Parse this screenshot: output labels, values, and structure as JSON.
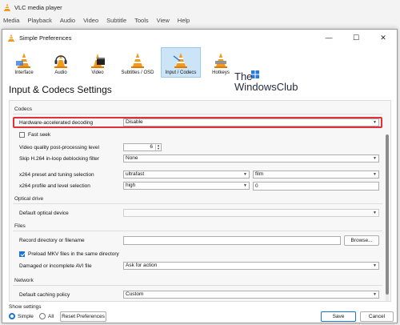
{
  "main_window": {
    "title": "VLC media player",
    "menu": [
      "Media",
      "Playback",
      "Audio",
      "Video",
      "Subtitle",
      "Tools",
      "View",
      "Help"
    ]
  },
  "dialog": {
    "title": "Simple Preferences",
    "window_buttons": {
      "minimize": "—",
      "maximize": "☐",
      "close": "✕"
    },
    "categories": [
      {
        "label": "Interface",
        "icon": "interface-cone-icon",
        "selected": false
      },
      {
        "label": "Audio",
        "icon": "audio-headphones-cone-icon",
        "selected": false
      },
      {
        "label": "Video",
        "icon": "video-clapper-cone-icon",
        "selected": false
      },
      {
        "label": "Subtitles / OSD",
        "icon": "subtitles-cone-icon",
        "selected": false
      },
      {
        "label": "Input / Codecs",
        "icon": "codecs-cone-icon",
        "selected": true
      },
      {
        "label": "Hotkeys",
        "icon": "hotkeys-cone-icon",
        "selected": false
      }
    ],
    "watermark": {
      "line1": "The",
      "line2": "WindowsClub"
    },
    "heading": "Input & Codecs Settings",
    "groups": {
      "codecs": "Codecs",
      "optical": "Optical drive",
      "files": "Files",
      "network": "Network"
    },
    "codecs": {
      "hw_decoding_label": "Hardware-accelerated decoding",
      "hw_decoding_value": "Disable",
      "fast_seek_label": "Fast seek",
      "fast_seek_checked": false,
      "vq_label": "Video quality post-processing level",
      "vq_value": "6",
      "skip_label": "Skip H.264 in-loop deblocking filter",
      "skip_value": "None",
      "x264_preset_label": "x264 preset and tuning selection",
      "x264_preset_value": "ultrafast",
      "x264_tune_value": "film",
      "x264_profile_label": "x264 profile and level selection",
      "x264_profile_value": "high",
      "x264_level_value": "0"
    },
    "optical": {
      "device_label": "Default optical device",
      "device_value": ""
    },
    "files": {
      "record_label": "Record directory or filename",
      "record_value": "",
      "browse_label": "Browse...",
      "preload_label": "Preload MKV files in the same directory",
      "preload_checked": true,
      "damaged_label": "Damaged or incomplete AVI file",
      "damaged_value": "Ask for action"
    },
    "network": {
      "caching_label": "Default caching policy",
      "caching_value": "Custom"
    },
    "footer": {
      "show_settings": "Show settings",
      "simple": "Simple",
      "all": "All",
      "reset": "Reset Preferences",
      "save": "Save",
      "cancel": "Cancel"
    },
    "accent": "#1a73d8",
    "highlight_color": "#e0313a"
  }
}
